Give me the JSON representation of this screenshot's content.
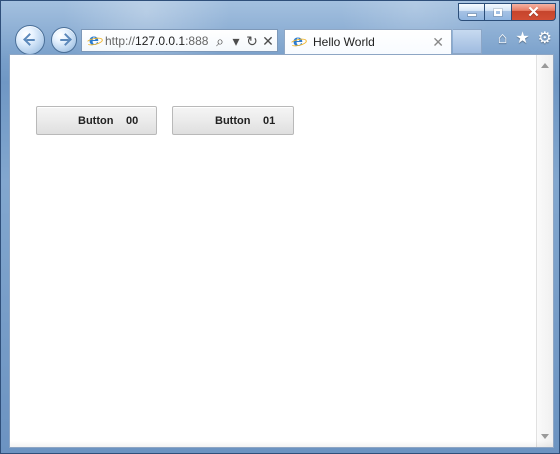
{
  "window": {
    "accent": "#6f97c4",
    "close_color": "#c5442c"
  },
  "browser": {
    "address_prefix": "http://",
    "address_host": "127.0.0.1",
    "address_suffix": ":888",
    "tab_title": "Hello World"
  },
  "toolbar": {
    "search_icon": "search-icon",
    "dropdown_icon": "chevron-down-icon",
    "refresh_icon": "refresh-icon",
    "stop_icon": "close-icon",
    "home_icon": "home-icon",
    "favorites_icon": "star-icon",
    "settings_icon": "gear-icon"
  },
  "page": {
    "buttons": [
      {
        "label": "Button",
        "value": "00"
      },
      {
        "label": "Button",
        "value": "01"
      }
    ]
  }
}
